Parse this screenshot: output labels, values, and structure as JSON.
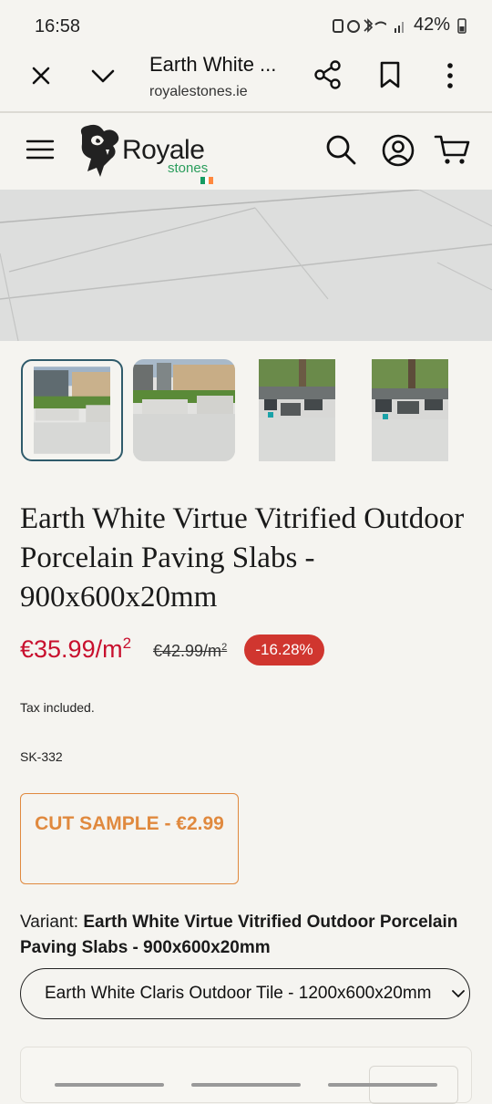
{
  "status_bar": {
    "time": "16:58",
    "battery": "42%"
  },
  "browser": {
    "tab_title": "Earth White ...",
    "url": "royalestones.ie",
    "icons": [
      "close-icon",
      "chevron-down-icon",
      "share-icon",
      "bookmark-icon",
      "more-vert-icon"
    ]
  },
  "site": {
    "logo_name": "Royale",
    "logo_sub": "stones",
    "icons": [
      "menu-icon",
      "search-icon",
      "account-icon",
      "cart-icon"
    ]
  },
  "gallery": {
    "thumbnails": [
      "thumbnail-1",
      "thumbnail-2",
      "thumbnail-3",
      "thumbnail-4"
    ],
    "selected_index": 0
  },
  "product": {
    "title": "Earth White Virtue Vitrified Outdoor Porcelain Paving Slabs - 900x600x20mm",
    "price": "€35.99/m",
    "price_unit_sup": "2",
    "compare_price": "€42.99/m",
    "compare_unit_sup": "2",
    "discount_badge": "-16.28%",
    "tax_note": "Tax included.",
    "sku": "SK-332",
    "sample_button": "CUT SAMPLE - €2.99",
    "variant_label": "Variant: ",
    "variant_value": "Earth White Virtue Vitrified Outdoor Porcelain Paving Slabs - 900x600x20mm",
    "variant_select_value": "Earth White Claris Outdoor Tile - 1200x600x20mm"
  },
  "colors": {
    "background": "#f5f4f0",
    "price_red": "#c8102e",
    "badge_red": "#d0362f",
    "sample_orange": "#e0893e",
    "selected_thumb_border": "#2f5b6b",
    "logo_green": "#2a9d5c"
  }
}
